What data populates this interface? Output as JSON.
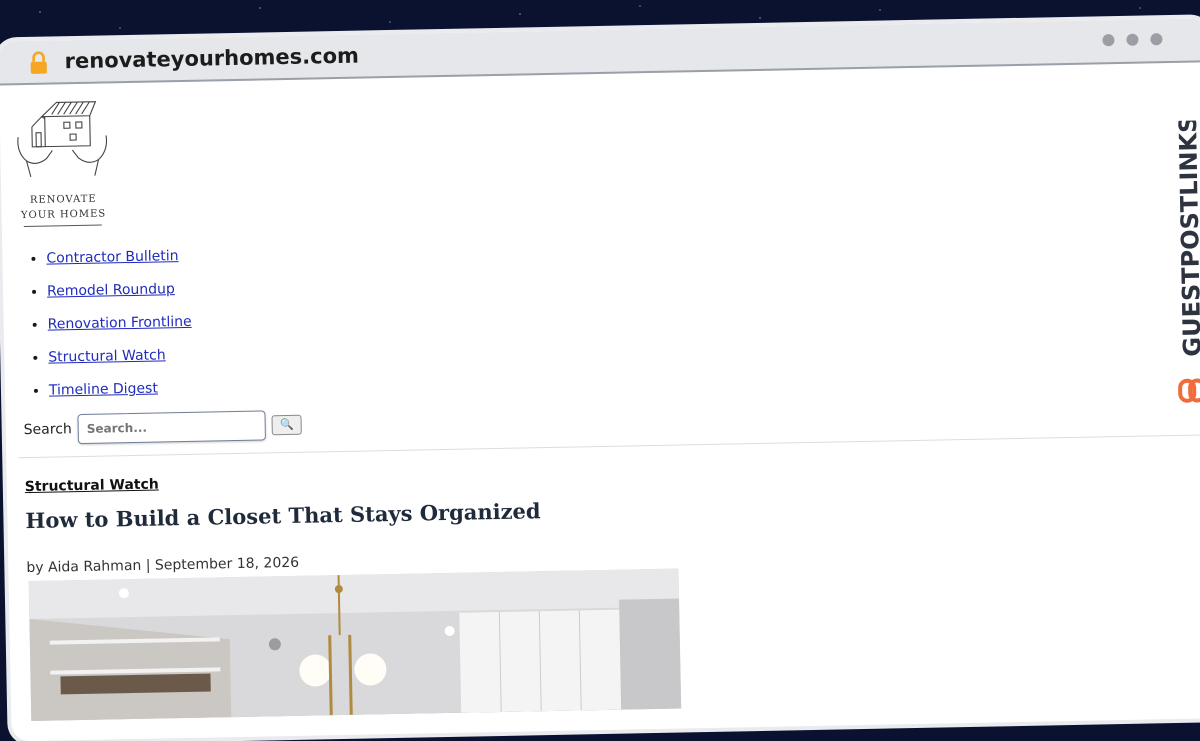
{
  "browser": {
    "url": "renovateyourhomes.com"
  },
  "logo": {
    "line1": "RENOVATE",
    "line2": "YOUR HOMES"
  },
  "nav": {
    "items": [
      {
        "label": "Contractor Bulletin"
      },
      {
        "label": "Remodel Roundup"
      },
      {
        "label": "Renovation Frontline"
      },
      {
        "label": "Structural Watch"
      },
      {
        "label": "Timeline Digest"
      }
    ]
  },
  "search": {
    "label": "Search",
    "placeholder": "Search...",
    "button_icon": "magnifier-icon",
    "button_glyph": "🔍"
  },
  "article": {
    "category": "Structural Watch",
    "title": "How to Build a Closet That Stays Organized",
    "meta": "by Aida Rahman | September 18, 2026"
  },
  "side_brand": {
    "text": "GUESTPOSTLINKS",
    "accent_color": "#f26b3a"
  }
}
